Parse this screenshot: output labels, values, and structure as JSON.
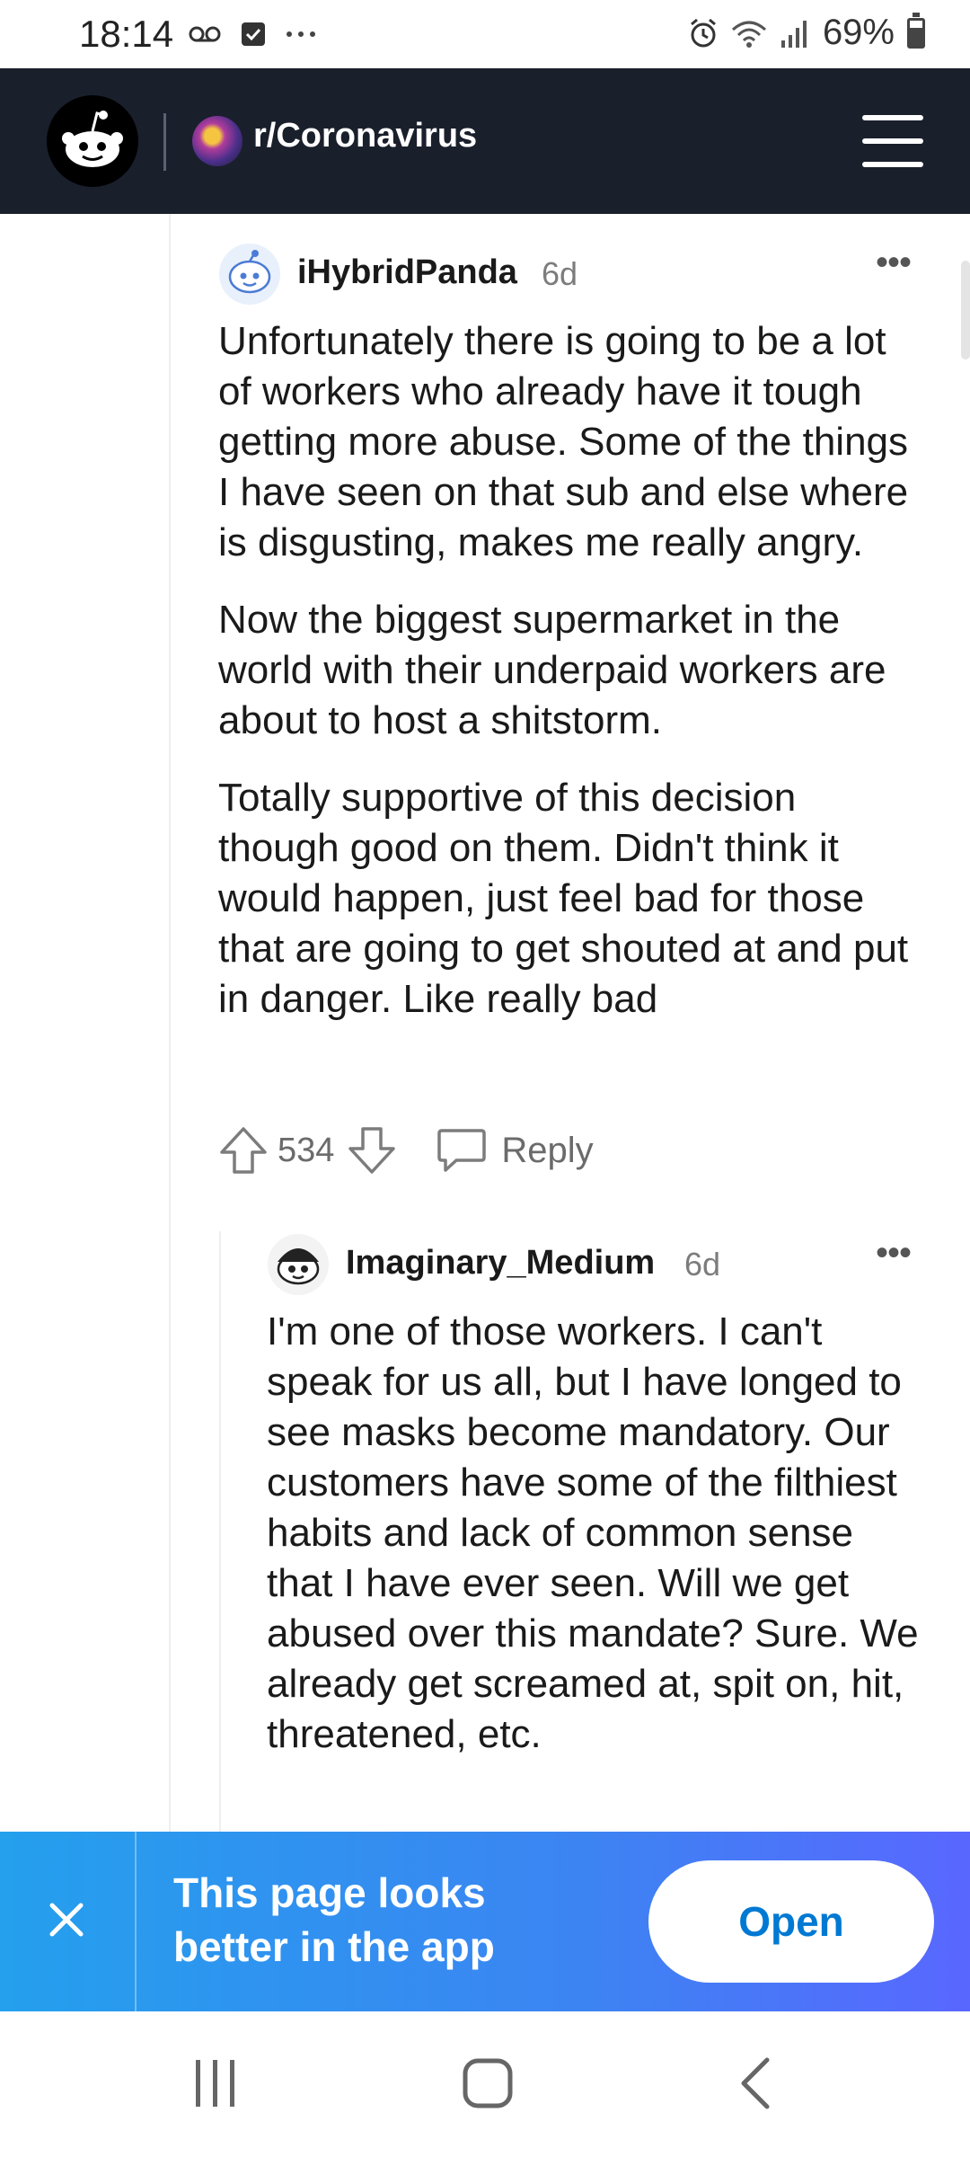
{
  "status_bar": {
    "time": "18:14",
    "battery_text": "69%",
    "battery_level_percent": 69,
    "left_icons": [
      "voicemail-icon",
      "checkbox-icon",
      "more-dots-icon"
    ],
    "right_icons": [
      "alarm-icon",
      "wifi-icon",
      "signal-icon",
      "battery-icon"
    ]
  },
  "header": {
    "subreddit": "r/Coronavirus",
    "logo_icon": "reddit-snoo-icon",
    "menu_icon": "hamburger-menu-icon",
    "bg_color": "#1a1f2c"
  },
  "comments": [
    {
      "author": "iHybridPanda",
      "age": "6d",
      "more": "•••",
      "paragraphs": [
        "Unfortunately there is going to be a lot of workers who already have it tough getting more abuse. Some of the things I have seen on that sub and else where is disgusting, makes me really angry.",
        "Now the biggest supermarket in the world with their underpaid workers are about to host a shitstorm.",
        "Totally supportive of this decision though good on them. Didn't think it would happen, just feel bad for those that are going to get shouted at and put in danger. Like really bad"
      ],
      "votes": "534",
      "reply_label": "Reply"
    },
    {
      "author": "Imaginary_Medium",
      "age": "6d",
      "more": "•••",
      "paragraphs": [
        "I'm one of those workers. I can't speak for us all, but I have longed to see masks become mandatory. Our customers have some of the filthiest habits and lack of common sense that I have ever seen. Will we get abused over this mandate? Sure. We already get screamed at, spit on, hit, threatened, etc."
      ]
    }
  ],
  "banner": {
    "text": "This page looks better in the app",
    "open_label": "Open",
    "close_icon": "close-icon"
  },
  "nav_bar": {
    "icons": [
      "recents-icon",
      "home-icon",
      "back-icon"
    ]
  }
}
